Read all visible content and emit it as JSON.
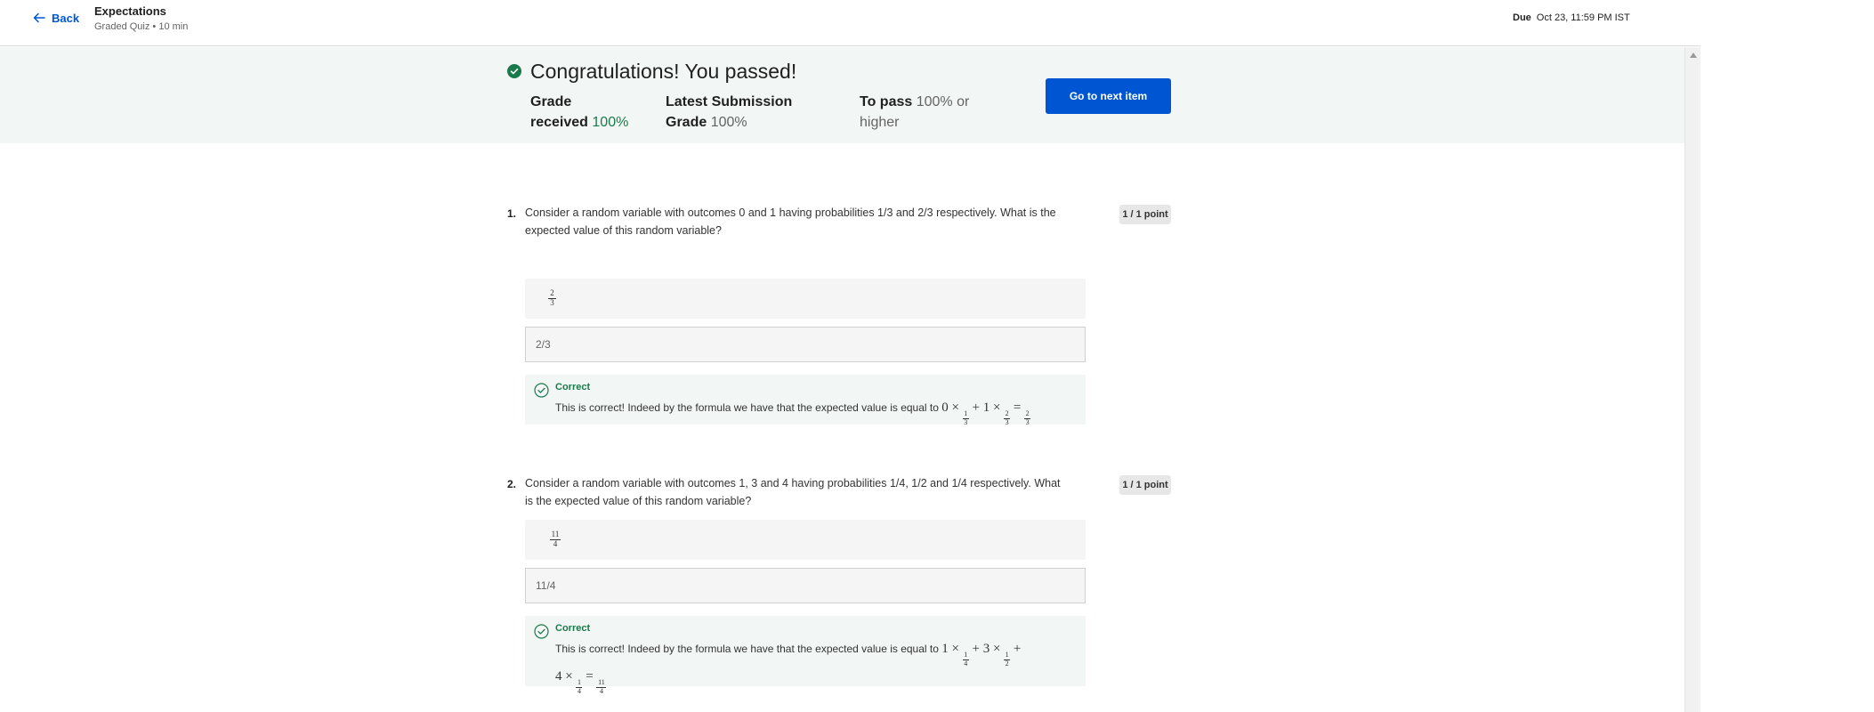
{
  "header": {
    "back_label": "Back",
    "title": "Expectations",
    "subtitle": "Graded Quiz • 10 min",
    "due_label": "Due",
    "due_value": "Oct 23, 11:59 PM IST"
  },
  "banner": {
    "heading": "Congratulations! You passed!",
    "grade_label_1": "Grade",
    "grade_label_2": "received",
    "grade_value": "100%",
    "latest_label_1": "Latest Submission",
    "latest_label_2": "Grade",
    "latest_value": "100%",
    "pass_label": "To pass",
    "pass_value_1": "100% or",
    "pass_value_2": "higher",
    "next_button": "Go to next item"
  },
  "questions": [
    {
      "number": "1.",
      "text": "Consider a random variable with outcomes 0 and 1 having probabilities 1/3 and 2/3 respectively. What is the expected value of this random variable?",
      "points": "1 / 1 point",
      "preview_num": "2",
      "preview_den": "3",
      "answer": "2/3",
      "feedback_label": "Correct",
      "feedback_text": "This is correct! Indeed by the formula we have that the expected value is equal to",
      "expr_parts": [
        "0",
        "×",
        "1/3",
        "+",
        "1",
        "×",
        "2/3",
        "=",
        "2/3"
      ]
    },
    {
      "number": "2.",
      "text": "Consider a random variable with outcomes 1, 3 and 4 having probabilities 1/4, 1/2 and 1/4 respectively. What is the expected value of this random variable?",
      "points": "1 / 1 point",
      "preview_num": "11",
      "preview_den": "4",
      "answer": "11/4",
      "feedback_label": "Correct",
      "feedback_text": "This is correct! Indeed by the formula we have that the expected value is equal to",
      "expr_line1": [
        "1",
        "×",
        "1/4",
        "+",
        "3",
        "×",
        "1/2",
        "+"
      ],
      "expr_line2": [
        "4",
        "×",
        "1/4",
        "=",
        "11/4"
      ]
    }
  ],
  "colors": {
    "accent": "#0056d2",
    "success": "#1b7a4b",
    "banner_bg": "#f2f7f5"
  }
}
